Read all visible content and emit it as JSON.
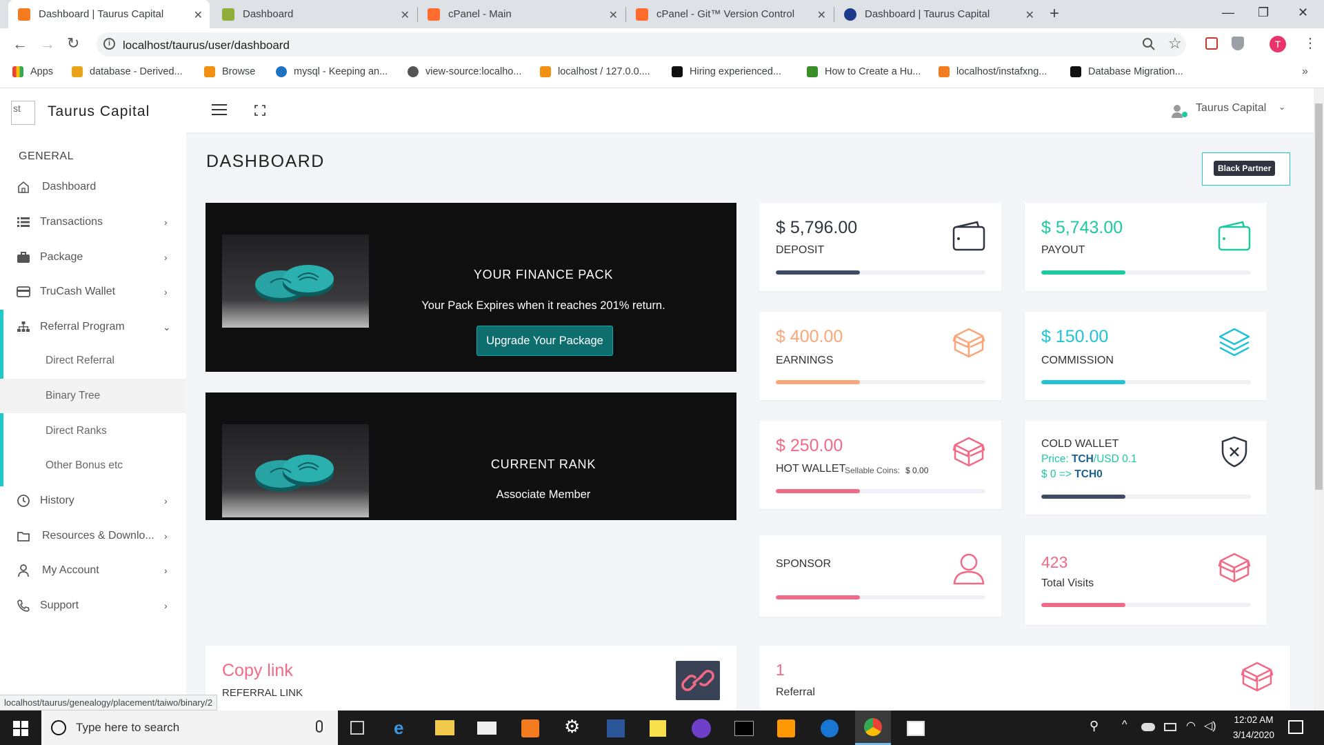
{
  "browser": {
    "tabs": [
      {
        "title": "Dashboard | Taurus Capital",
        "active": true
      },
      {
        "title": "Dashboard"
      },
      {
        "title": "cPanel - Main"
      },
      {
        "title": "cPanel - Git™ Version Control"
      },
      {
        "title": "Dashboard | Taurus Capital"
      }
    ],
    "url": "localhost/taurus/user/dashboard",
    "bookmarks": [
      "Apps",
      "database - Derived...",
      "Browse",
      "mysql - Keeping an...",
      "view-source:localho...",
      "localhost / 127.0.0....",
      "Hiring experienced...",
      "How to Create a Hu...",
      "localhost/instafxng...",
      "Database Migration..."
    ],
    "profile_initial": "T",
    "status_url": "localhost/taurus/genealogy/placement/taiwo/binary/2"
  },
  "app": {
    "brand": "Taurus Capital",
    "logo_alt": "st",
    "user_menu": "Taurus Capital",
    "page_title": "DASHBOARD",
    "badge": "Black Partner"
  },
  "sidebar": {
    "section": "GENERAL",
    "items": [
      {
        "label": "Dashboard",
        "icon": "home-icon"
      },
      {
        "label": "Transactions",
        "icon": "list-icon"
      },
      {
        "label": "Package",
        "icon": "briefcase-icon"
      },
      {
        "label": "TruCash Wallet",
        "icon": "card-icon"
      },
      {
        "label": "Referral Program",
        "icon": "sitemap-icon"
      },
      {
        "label": "History",
        "icon": "clock-icon"
      },
      {
        "label": "Resources & Downlo...",
        "icon": "folder-icon"
      },
      {
        "label": "My Account",
        "icon": "user-icon"
      },
      {
        "label": "Support",
        "icon": "phone-icon"
      }
    ],
    "subitems": [
      "Direct Referral",
      "Binary Tree",
      "Direct Ranks",
      "Other Bonus etc"
    ]
  },
  "finance_pack": {
    "title": "YOUR FINANCE PACK",
    "text": "Your Pack Expires when it reaches 201% return.",
    "button": "Upgrade Your Package"
  },
  "current_rank": {
    "title": "CURRENT RANK",
    "value": "Associate Member"
  },
  "stats": {
    "deposit": {
      "amount": "$ 5,796.00",
      "label": "DEPOSIT",
      "progress": 0.4,
      "color": "#3e4a66"
    },
    "payout": {
      "amount": "$ 5,743.00",
      "label": "PAYOUT",
      "progress": 0.4,
      "color": "#1dc9a1"
    },
    "earnings": {
      "amount": "$ 400.00",
      "label": "EARNINGS",
      "progress": 0.4,
      "color": "#fba678"
    },
    "commission": {
      "amount": "$ 150.00",
      "label": "COMMISSION",
      "progress": 0.4,
      "color": "#20c3d6"
    },
    "hot_wallet": {
      "amount": "$ 250.00",
      "label": "HOT WALLET",
      "sub": "Sellable Coins:",
      "sub_value": "$ 0.00",
      "progress": 0.4,
      "color": "#f16a86"
    },
    "cold_wallet": {
      "label": "COLD WALLET",
      "price_prefix": "Price:",
      "price_pair": "TCH",
      "price_rest": "/USD 0.1",
      "conv_prefix": "$ 0 =>",
      "conv_unit": "TCH0",
      "progress": 0.4,
      "color": "#3e4a66"
    },
    "sponsor": {
      "label": "SPONSOR",
      "progress": 0.4,
      "color": "#f16a86"
    },
    "visits": {
      "amount": "423",
      "label": "Total Visits",
      "progress": 0.4,
      "color": "#f16a86"
    }
  },
  "copy_link": {
    "title": "Copy link",
    "sub": "REFERRAL LINK"
  },
  "referral": {
    "amount": "1",
    "label": "Referral"
  },
  "taskbar": {
    "search_placeholder": "Type here to search",
    "time": "12:02 AM",
    "date": "3/14/2020"
  }
}
